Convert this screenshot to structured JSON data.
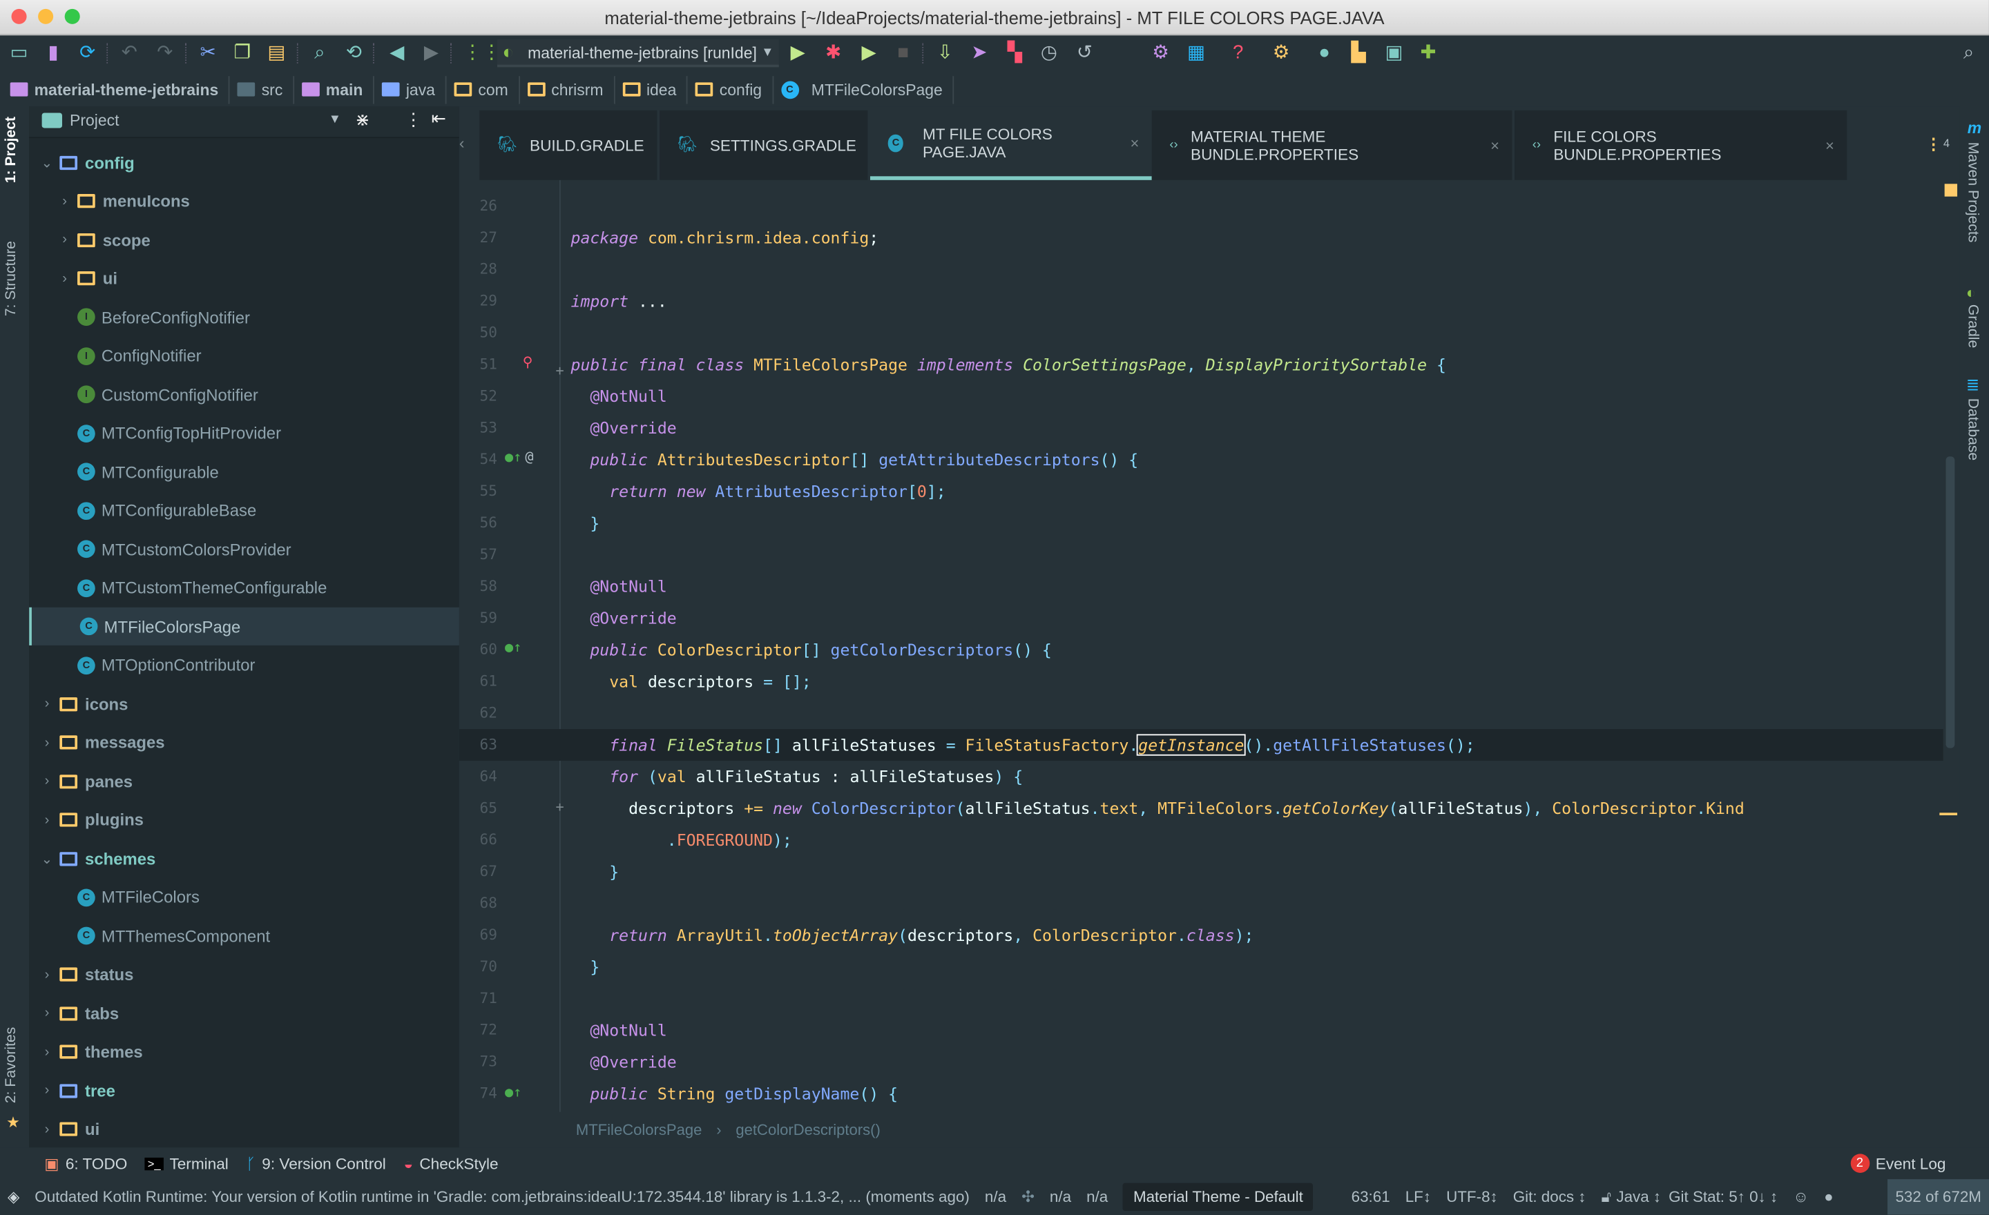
{
  "window": {
    "title": "material-theme-jetbrains [~/IdeaProjects/material-theme-jetbrains] - MT FILE COLORS PAGE.JAVA"
  },
  "toolbar": {
    "run_config": "material-theme-jetbrains [runIde]"
  },
  "breadcrumbs": [
    "material-theme-jetbrains",
    "src",
    "main",
    "java",
    "com",
    "chrisrm",
    "idea",
    "config",
    "MTFileColorsPage"
  ],
  "left_strip": {
    "project": "1: Project",
    "structure": "7: Structure",
    "favorites": "2: Favorites"
  },
  "right_strip": {
    "maven": "Maven Projects",
    "gradle": "Gradle",
    "database": "Database"
  },
  "project_panel": {
    "title": "Project",
    "tree": [
      {
        "label": "config",
        "kind": "folder-open",
        "level": 0,
        "style": "accent"
      },
      {
        "label": "menuIcons",
        "kind": "folder",
        "level": 1,
        "style": "bold"
      },
      {
        "label": "scope",
        "kind": "folder",
        "level": 1,
        "style": "bold"
      },
      {
        "label": "ui",
        "kind": "folder",
        "level": 1,
        "style": "bold"
      },
      {
        "label": "BeforeConfigNotifier",
        "kind": "interface",
        "level": 1
      },
      {
        "label": "ConfigNotifier",
        "kind": "interface",
        "level": 1
      },
      {
        "label": "CustomConfigNotifier",
        "kind": "interface",
        "level": 1
      },
      {
        "label": "MTConfigTopHitProvider",
        "kind": "class",
        "level": 1
      },
      {
        "label": "MTConfigurable",
        "kind": "class",
        "level": 1
      },
      {
        "label": "MTConfigurableBase",
        "kind": "class",
        "level": 1
      },
      {
        "label": "MTCustomColorsProvider",
        "kind": "class",
        "level": 1
      },
      {
        "label": "MTCustomThemeConfigurable",
        "kind": "class",
        "level": 1
      },
      {
        "label": "MTFileColorsPage",
        "kind": "class",
        "level": 1,
        "selected": true
      },
      {
        "label": "MTOptionContributor",
        "kind": "class",
        "level": 1
      },
      {
        "label": "icons",
        "kind": "folder",
        "level": 0,
        "style": "bold"
      },
      {
        "label": "messages",
        "kind": "folder",
        "level": 0,
        "style": "bold"
      },
      {
        "label": "panes",
        "kind": "folder",
        "level": 0,
        "style": "bold"
      },
      {
        "label": "plugins",
        "kind": "folder",
        "level": 0,
        "style": "bold"
      },
      {
        "label": "schemes",
        "kind": "folder-open",
        "level": 0,
        "style": "accent"
      },
      {
        "label": "MTFileColors",
        "kind": "class",
        "level": 1
      },
      {
        "label": "MTThemesComponent",
        "kind": "class",
        "level": 1
      },
      {
        "label": "status",
        "kind": "folder",
        "level": 0,
        "style": "bold"
      },
      {
        "label": "tabs",
        "kind": "folder",
        "level": 0,
        "style": "bold"
      },
      {
        "label": "themes",
        "kind": "folder",
        "level": 0,
        "style": "bold"
      },
      {
        "label": "tree",
        "kind": "folder-blue",
        "level": 0,
        "style": "accent"
      },
      {
        "label": "ui",
        "kind": "folder",
        "level": 0,
        "style": "bold"
      }
    ]
  },
  "tabs": [
    {
      "label": "BUILD.GRADLE",
      "icon": "gradle-icon"
    },
    {
      "label": "SETTINGS.GRADLE",
      "icon": "gradle-icon"
    },
    {
      "label": "MT FILE COLORS PAGE.JAVA",
      "icon": "java-class-icon",
      "active": true
    },
    {
      "label": "MATERIAL THEME BUNDLE.PROPERTIES",
      "icon": "properties-icon"
    },
    {
      "label": "FILE COLORS BUNDLE.PROPERTIES",
      "icon": "properties-icon"
    }
  ],
  "tabs_overflow_count": "4",
  "code": [
    {
      "n": "26",
      "t": []
    },
    {
      "n": "27",
      "t": [
        [
          "package ",
          "kw"
        ],
        [
          "com.chrisrm.idea.config",
          "val"
        ],
        [
          ";",
          "plain"
        ]
      ]
    },
    {
      "n": "28",
      "t": []
    },
    {
      "n": "29",
      "t": [
        [
          "import ",
          "kw"
        ],
        [
          "...",
          "plain"
        ]
      ]
    },
    {
      "n": "50",
      "t": []
    },
    {
      "n": "51",
      "t": [
        [
          "public final class ",
          "kw"
        ],
        [
          "MTFileColorsPage ",
          "type"
        ],
        [
          "implements ",
          "kw"
        ],
        [
          "ColorSettingsPage",
          "iface"
        ],
        [
          ", ",
          "punc"
        ],
        [
          "DisplayPrioritySortable ",
          "iface"
        ],
        [
          "{",
          "punc"
        ]
      ]
    },
    {
      "n": "52",
      "t": [
        [
          "  @NotNull",
          "ann"
        ]
      ]
    },
    {
      "n": "53",
      "t": [
        [
          "  @Override",
          "ann"
        ]
      ]
    },
    {
      "n": "54",
      "t": [
        [
          "  public ",
          "kw"
        ],
        [
          "AttributesDescriptor",
          "type"
        ],
        [
          "[] ",
          "punc"
        ],
        [
          "getAttributeDescriptors",
          "fn"
        ],
        [
          "() {",
          "punc"
        ]
      ]
    },
    {
      "n": "55",
      "t": [
        [
          "    return new ",
          "kw"
        ],
        [
          "AttributesDescriptor",
          "fn"
        ],
        [
          "[",
          "punc"
        ],
        [
          "0",
          "num"
        ],
        [
          "];",
          "punc"
        ]
      ]
    },
    {
      "n": "56",
      "t": [
        [
          "  }",
          "punc"
        ]
      ]
    },
    {
      "n": "57",
      "t": []
    },
    {
      "n": "58",
      "t": [
        [
          "  @NotNull",
          "ann"
        ]
      ]
    },
    {
      "n": "59",
      "t": [
        [
          "  @Override",
          "ann"
        ]
      ]
    },
    {
      "n": "60",
      "t": [
        [
          "  public ",
          "kw"
        ],
        [
          "ColorDescriptor",
          "type"
        ],
        [
          "[] ",
          "punc"
        ],
        [
          "getColorDescriptors",
          "fn"
        ],
        [
          "() {",
          "punc"
        ]
      ]
    },
    {
      "n": "61",
      "t": [
        [
          "    val ",
          "val"
        ],
        [
          "descriptors ",
          "plain"
        ],
        [
          "= ",
          "punc"
        ],
        [
          "[];",
          "punc"
        ]
      ]
    },
    {
      "n": "62",
      "t": []
    },
    {
      "n": "63",
      "t": [
        [
          "    final ",
          "kw"
        ],
        [
          "FileStatus",
          "iface"
        ],
        [
          "[] ",
          "punc"
        ],
        [
          "allFileStatuses ",
          "plain"
        ],
        [
          "= ",
          "punc"
        ],
        [
          "FileStatusFactory",
          "type"
        ],
        [
          ".",
          "punc"
        ],
        [
          "getInstance",
          "fni box"
        ],
        [
          "().",
          "punc"
        ],
        [
          "getAllFileStatuses",
          "fn"
        ],
        [
          "();",
          "punc"
        ]
      ],
      "current": true
    },
    {
      "n": "64",
      "t": [
        [
          "    for ",
          "kw"
        ],
        [
          "(",
          "punc"
        ],
        [
          "val ",
          "val"
        ],
        [
          "allFileStatus : allFileStatuses",
          "plain"
        ],
        [
          ") {",
          "punc"
        ]
      ]
    },
    {
      "n": "65",
      "t": [
        [
          "      descriptors ",
          "plain"
        ],
        [
          "+= ",
          "val"
        ],
        [
          "new ",
          "kw"
        ],
        [
          "ColorDescriptor",
          "fn"
        ],
        [
          "(",
          "punc"
        ],
        [
          "allFileStatus",
          "plain"
        ],
        [
          ".",
          "punc"
        ],
        [
          "text",
          "val"
        ],
        [
          ", ",
          "punc"
        ],
        [
          "MTFileColors",
          "type"
        ],
        [
          ".",
          "punc"
        ],
        [
          "getColorKey",
          "fni"
        ],
        [
          "(",
          "punc"
        ],
        [
          "allFileStatus",
          "plain"
        ],
        [
          "), ",
          "punc"
        ],
        [
          "ColorDescriptor",
          "type"
        ],
        [
          ".",
          "punc"
        ],
        [
          "Kind",
          "type"
        ]
      ]
    },
    {
      "n": "66",
      "t": [
        [
          "          .",
          "punc"
        ],
        [
          "FOREGROUND",
          "stat"
        ],
        [
          ");",
          "punc"
        ]
      ]
    },
    {
      "n": "67",
      "t": [
        [
          "    }",
          "punc"
        ]
      ]
    },
    {
      "n": "68",
      "t": []
    },
    {
      "n": "69",
      "t": [
        [
          "    return ",
          "kw"
        ],
        [
          "ArrayUtil",
          "type"
        ],
        [
          ".",
          "punc"
        ],
        [
          "toObjectArray",
          "fni"
        ],
        [
          "(",
          "punc"
        ],
        [
          "descriptors",
          "plain"
        ],
        [
          ", ",
          "punc"
        ],
        [
          "ColorDescriptor",
          "type"
        ],
        [
          ".",
          "punc"
        ],
        [
          "class",
          "kw"
        ],
        [
          ");",
          "punc"
        ]
      ]
    },
    {
      "n": "70",
      "t": [
        [
          "  }",
          "punc"
        ]
      ]
    },
    {
      "n": "71",
      "t": []
    },
    {
      "n": "72",
      "t": [
        [
          "  @NotNull",
          "ann"
        ]
      ]
    },
    {
      "n": "73",
      "t": [
        [
          "  @Override",
          "ann"
        ]
      ]
    },
    {
      "n": "74",
      "t": [
        [
          "  public ",
          "kw"
        ],
        [
          "String ",
          "type"
        ],
        [
          "getDisplayName",
          "fn"
        ],
        [
          "() {",
          "punc"
        ]
      ]
    }
  ],
  "code_breadcrumb": [
    "MTFileColorsPage",
    "getColorDescriptors()"
  ],
  "bottom_tools": [
    "6: TODO",
    "Terminal",
    "9: Version Control",
    "CheckStyle"
  ],
  "event_log": {
    "label": "Event Log",
    "count": "2"
  },
  "status": {
    "message": "Outdated Kotlin Runtime: Your version of Kotlin runtime in 'Gradle: com.jetbrains:ideaIU:172.3544.18' library is 1.1.3-2, ... (moments ago)",
    "na1": "n/a",
    "na2": "n/a",
    "na3": "n/a",
    "theme": "Material Theme - Default",
    "position": "63:61",
    "line_sep": "LF↕",
    "encoding": "UTF-8↕",
    "git": "Git: docs ↕",
    "lang": "Java ↕",
    "git_stat": "Git Stat: 5↑ 0↓ ↕",
    "memory": "532 of 672M"
  },
  "colors": {
    "accent": "#80cbc4",
    "bg": "#263238",
    "panel": "#1f292e"
  }
}
